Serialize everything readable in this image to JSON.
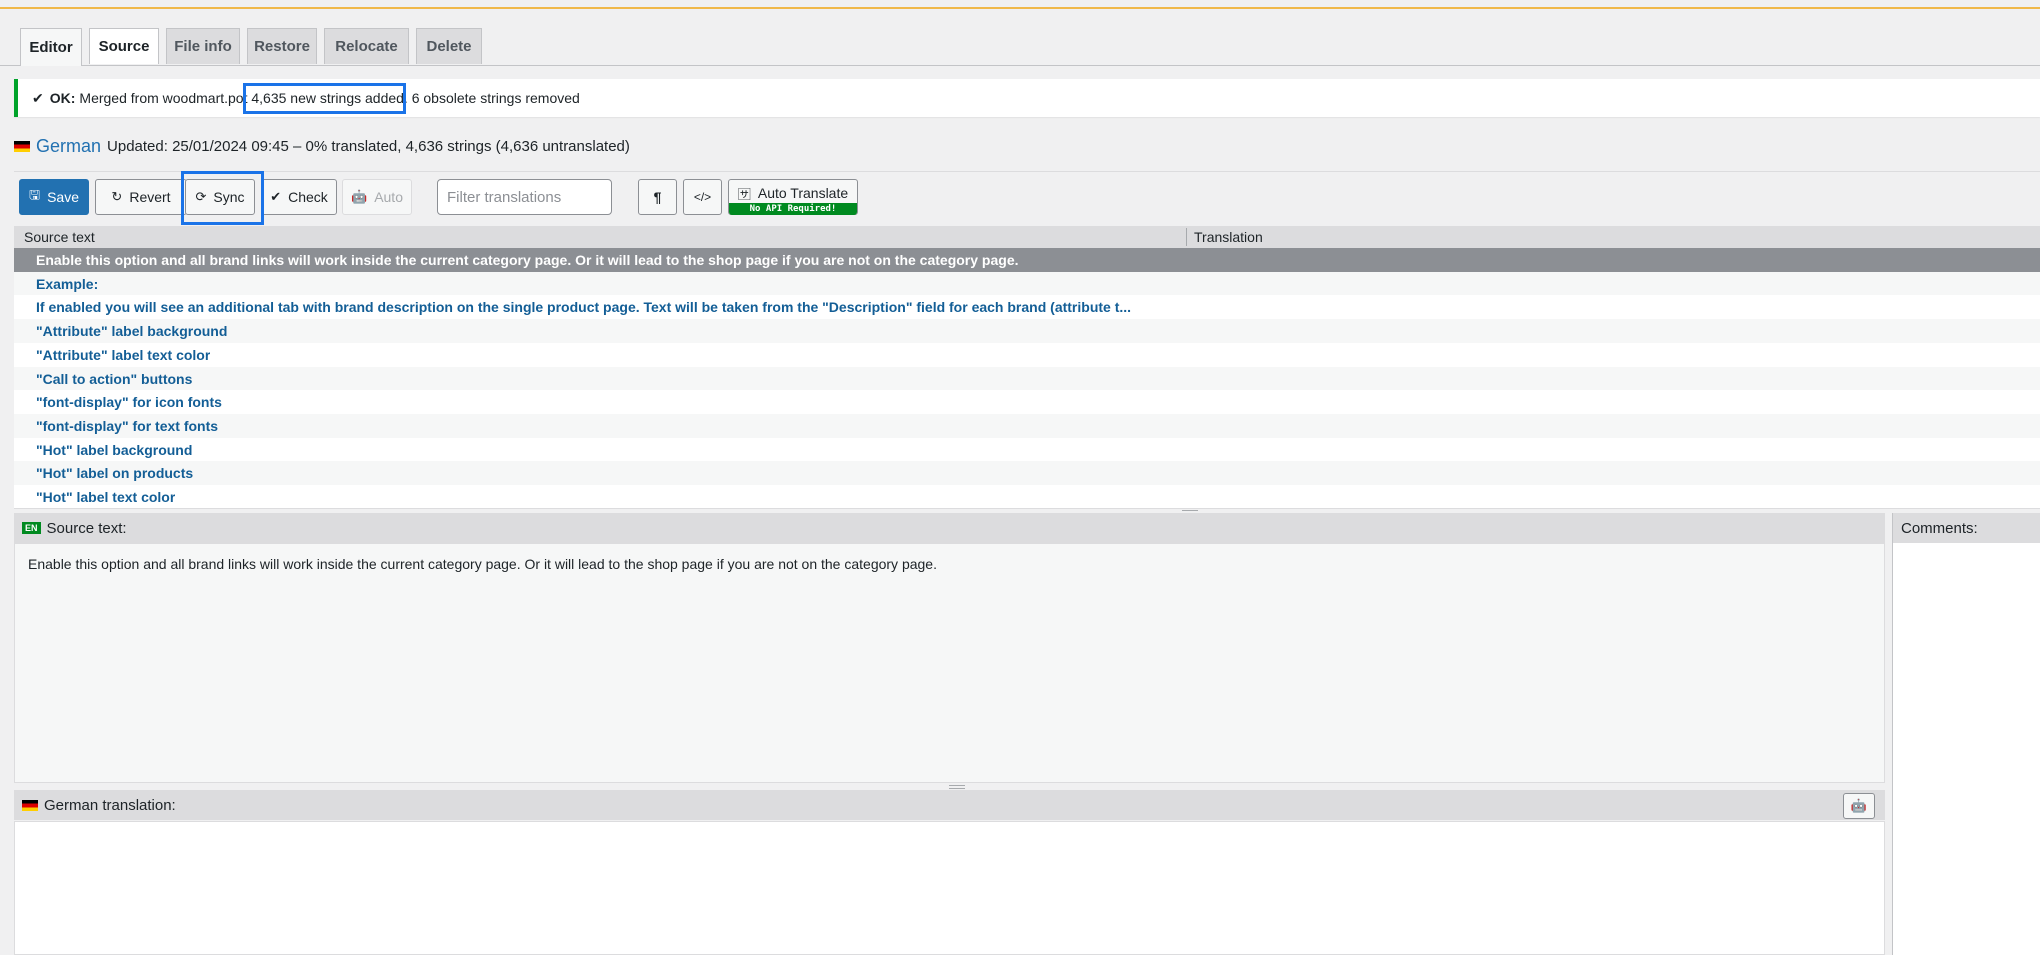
{
  "tabs": [
    {
      "label": "Editor"
    },
    {
      "label": "Source"
    },
    {
      "label": "File info"
    },
    {
      "label": "Restore"
    },
    {
      "label": "Relocate"
    },
    {
      "label": "Delete"
    }
  ],
  "notice": {
    "status": "OK:",
    "merged": "Merged from woodmart.pot",
    "added": "4,635 new strings added.",
    "removed": "6 obsolete strings removed"
  },
  "header": {
    "language": "German",
    "updated": "Updated: 25/01/2024 09:45 – 0% translated, 4,636 strings (4,636 untranslated)"
  },
  "toolbar": {
    "save": "Save",
    "revert": "Revert",
    "sync": "Sync",
    "check": "Check",
    "auto": "Auto",
    "filter_placeholder": "Filter translations",
    "pilcrow": "¶",
    "code": "</>",
    "auto_translate": "Auto Translate",
    "no_api": "No API Required!"
  },
  "list": {
    "col_source": "Source text",
    "col_translation": "Translation",
    "rows": [
      "Enable this option and all brand links will work inside the current category page. Or it will lead to the shop page if you are not on the category page.",
      "Example:",
      "If enabled you will see an additional tab with brand description on the single product page. Text will be taken from the \"Description\" field for each brand (attribute t...",
      "\"Attribute\" label background",
      "\"Attribute\" label text color",
      "\"Call to action\" buttons",
      "\"font-display\" for icon fonts",
      "\"font-display\" for text fonts",
      "\"Hot\" label background",
      "\"Hot\" label on products",
      "\"Hot\" label text color"
    ]
  },
  "source_pane": {
    "badge": "EN",
    "title": "Source text:",
    "text": "Enable this option and all brand links will work inside the current category page. Or it will lead to the shop page if you are not on the category page."
  },
  "comments_pane": {
    "title": "Comments:"
  },
  "translation_pane": {
    "title": "German translation:"
  }
}
